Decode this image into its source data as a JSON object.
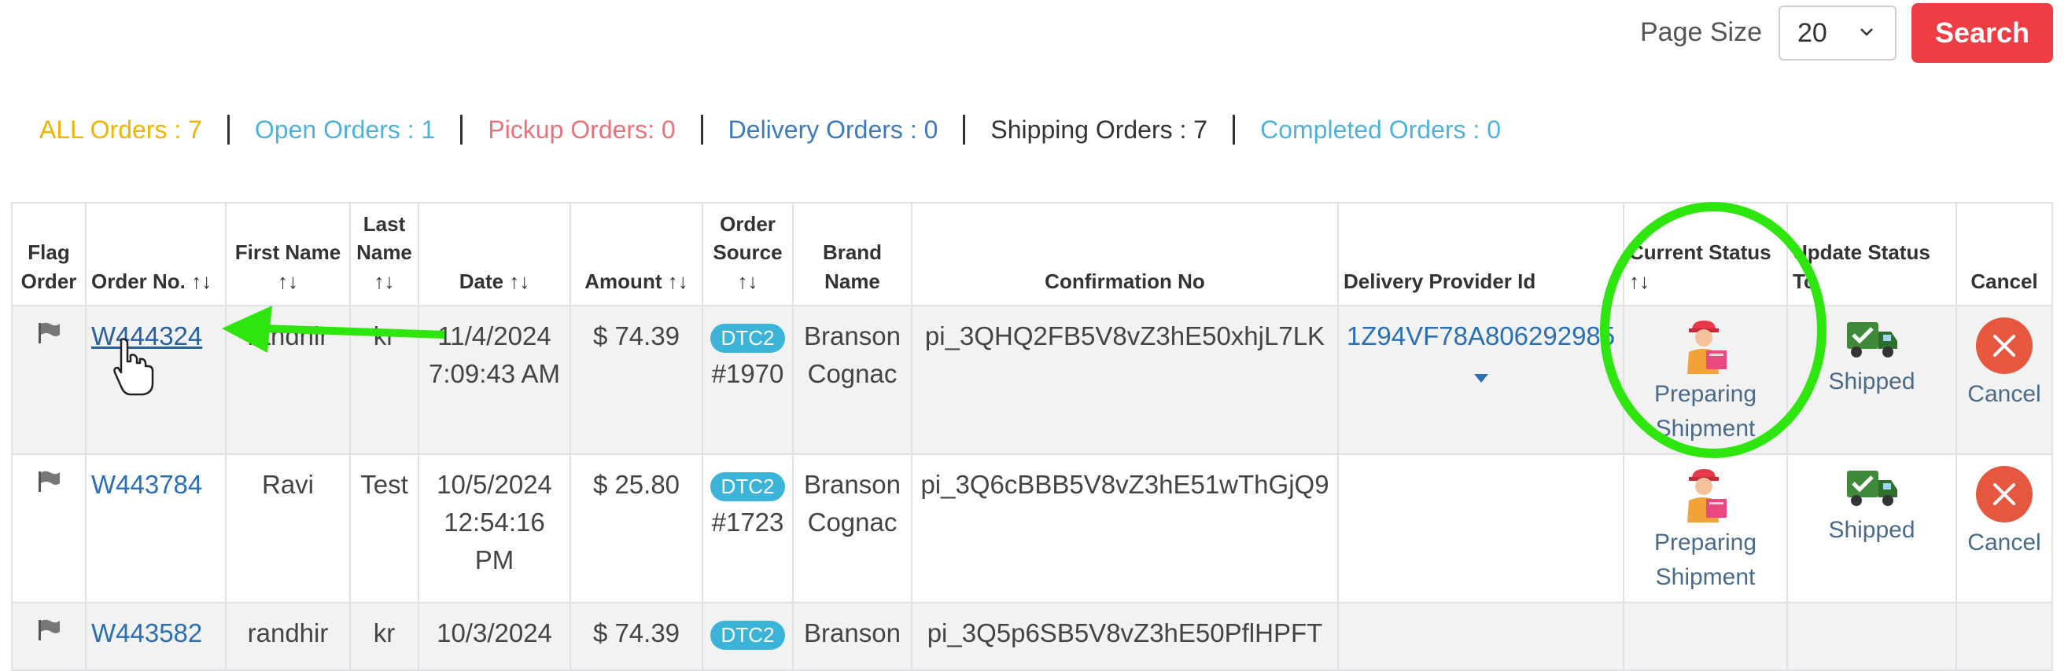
{
  "toolbar": {
    "page_size_label": "Page Size",
    "page_size_value": "20",
    "search_label": "Search"
  },
  "filters": [
    {
      "label": "ALL Orders : 7",
      "color": "#f0b400"
    },
    {
      "label": "Open Orders : 1",
      "color": "#4fb3d9"
    },
    {
      "label": "Pickup Orders: 0",
      "color": "#e8747a"
    },
    {
      "label": "Delivery Orders : 0",
      "color": "#3d7ab8"
    },
    {
      "label": "Shipping Orders : 7",
      "color": "#333333"
    },
    {
      "label": "Completed Orders : 0",
      "color": "#4fb3d9"
    }
  ],
  "table": {
    "headers": {
      "flag": "Flag Order",
      "order_no": "Order No.",
      "first_name": "First Name",
      "last_name": "Last Name",
      "date": "Date",
      "amount": "Amount",
      "order_source": "Order Source",
      "brand_name": "Brand Name",
      "confirmation_no": "Confirmation No",
      "delivery_provider": "Delivery Provider Id",
      "current_status": "Current Status",
      "update_status": "Update Status To",
      "cancel": "Cancel"
    },
    "sort_arrows": "↑↓",
    "rows": [
      {
        "order_no": "W444324",
        "first_name": "randhir",
        "last_name": "kr",
        "date_line1": "11/4/2024",
        "date_line2": "7:09:43 AM",
        "amount": "$ 74.39",
        "source_badge": "DTC2",
        "source_num": "#1970",
        "brand_line1": "Branson",
        "brand_line2": "Cognac",
        "confirmation": "pi_3QHQ2FB5V8vZ3hE50xhjL7LK",
        "provider_id": "1Z94VF78A806292985",
        "current_status_line1": "Preparing",
        "current_status_line2": "Shipment",
        "update_status": "Shipped",
        "cancel": "Cancel"
      },
      {
        "order_no": "W443784",
        "first_name": "Ravi",
        "last_name": "Test",
        "date_line1": "10/5/2024",
        "date_line2": "12:54:16",
        "date_line3": "PM",
        "amount": "$ 25.80",
        "source_badge": "DTC2",
        "source_num": "#1723",
        "brand_line1": "Branson",
        "brand_line2": "Cognac",
        "confirmation": "pi_3Q6cBBB5V8vZ3hE51wThGjQ9",
        "provider_id": "",
        "current_status_line1": "Preparing",
        "current_status_line2": "Shipment",
        "update_status": "Shipped",
        "cancel": "Cancel"
      },
      {
        "order_no": "W443582",
        "first_name": "randhir",
        "last_name": "kr",
        "date_line1": "10/3/2024",
        "amount": "$ 74.39",
        "source_badge": "DTC2",
        "brand_line1": "Branson",
        "confirmation": "pi_3Q5p6SB5V8vZ3hE50PflHPFT"
      }
    ]
  },
  "colors": {
    "search_button": "#ee3d43",
    "badge": "#3bb4d8",
    "link": "#2a6fb3",
    "annotation_green": "#2ee60e",
    "cancel_red": "#e5573f"
  },
  "icons": {
    "flag": "flag-icon",
    "preparing": "preparing-shipment-icon",
    "shipped": "shipped-truck-icon",
    "cancel": "cancel-x-icon",
    "cursor": "hand-pointer-icon"
  }
}
